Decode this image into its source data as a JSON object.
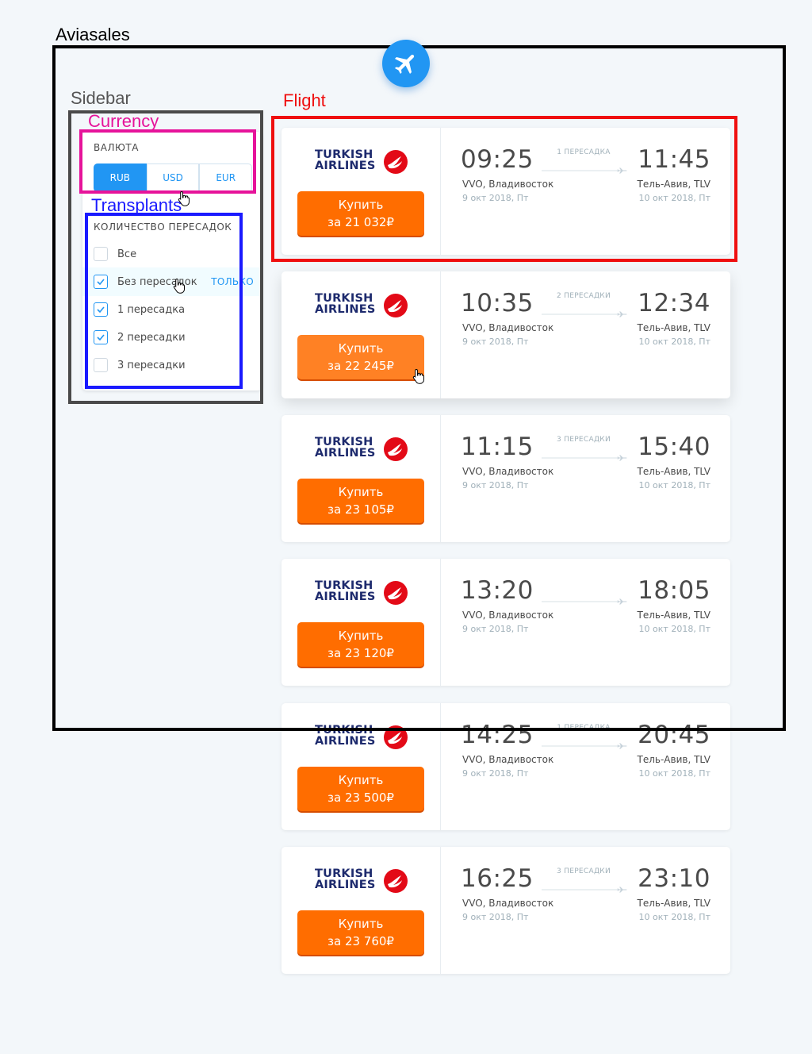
{
  "annotations": {
    "aviasales": "Aviasales",
    "sidebar": "Sidebar",
    "currency": "Currency",
    "transplants": "Transplants",
    "flight": "Flight",
    "colors": {
      "aviasales": "#000000",
      "sidebar": "#4a4a4a",
      "currency": "#e6139a",
      "transplants": "#1a1aff",
      "flight": "#ef0f0f"
    }
  },
  "logo": {
    "icon": "airplane-icon",
    "color": "#2196f3"
  },
  "sidebar": {
    "currency_title": "ВАЛЮТА",
    "currencies": [
      {
        "label": "RUB",
        "active": true
      },
      {
        "label": "USD",
        "active": false
      },
      {
        "label": "EUR",
        "active": false
      }
    ],
    "transfers_title": "КОЛИЧЕСТВО ПЕРЕСАДОК",
    "transfers": [
      {
        "label": "Все",
        "checked": false
      },
      {
        "label": "Без пересадок",
        "checked": true,
        "hover": true,
        "only": "ТОЛЬКО"
      },
      {
        "label": "1 пересадка",
        "checked": true
      },
      {
        "label": "2 пересадки",
        "checked": true
      },
      {
        "label": "3 пересадки",
        "checked": false
      }
    ]
  },
  "flights": [
    {
      "airline_line1": "TURKISH",
      "airline_line2": "AIRLINES",
      "buy_line1": "Купить",
      "buy_line2": "за 21 032₽",
      "dep_time": "09:25",
      "arr_time": "11:45",
      "stops": "1 ПЕРЕСАДКА",
      "dep_city": "VVO, Владивосток",
      "arr_city": "Тель-Авив, TLV",
      "dep_date": "9 окт 2018, Пт",
      "arr_date": "10 окт 2018, Пт"
    },
    {
      "airline_line1": "TURKISH",
      "airline_line2": "AIRLINES",
      "buy_line1": "Купить",
      "buy_line2": "за 22 245₽",
      "dep_time": "10:35",
      "arr_time": "12:34",
      "stops": "2 ПЕРЕСАДКИ",
      "dep_city": "VVO, Владивосток",
      "arr_city": "Тель-Авив, TLV",
      "dep_date": "9 окт 2018, Пт",
      "arr_date": "10 окт 2018, Пт"
    },
    {
      "airline_line1": "TURKISH",
      "airline_line2": "AIRLINES",
      "buy_line1": "Купить",
      "buy_line2": "за 23 105₽",
      "dep_time": "11:15",
      "arr_time": "15:40",
      "stops": "3 ПЕРЕСАДКИ",
      "dep_city": "VVO, Владивосток",
      "arr_city": "Тель-Авив, TLV",
      "dep_date": "9 окт 2018, Пт",
      "arr_date": "10 окт 2018, Пт"
    },
    {
      "airline_line1": "TURKISH",
      "airline_line2": "AIRLINES",
      "buy_line1": "Купить",
      "buy_line2": "за 23 120₽",
      "dep_time": "13:20",
      "arr_time": "18:05",
      "stops": "",
      "dep_city": "VVO, Владивосток",
      "arr_city": "Тель-Авив, TLV",
      "dep_date": "9 окт 2018, Пт",
      "arr_date": "10 окт 2018, Пт"
    },
    {
      "airline_line1": "TURKISH",
      "airline_line2": "AIRLINES",
      "buy_line1": "Купить",
      "buy_line2": "за 23 500₽",
      "dep_time": "14:25",
      "arr_time": "20:45",
      "stops": "1 ПЕРЕСАДКА",
      "dep_city": "VVO, Владивосток",
      "arr_city": "Тель-Авив, TLV",
      "dep_date": "9 окт 2018, Пт",
      "arr_date": "10 окт 2018, Пт"
    },
    {
      "airline_line1": "TURKISH",
      "airline_line2": "AIRLINES",
      "buy_line1": "Купить",
      "buy_line2": "за 23 760₽",
      "dep_time": "16:25",
      "arr_time": "23:10",
      "stops": "3 ПЕРЕСАДКИ",
      "dep_city": "VVO, Владивосток",
      "arr_city": "Тель-Авив, TLV",
      "dep_date": "9 окт 2018, Пт",
      "arr_date": "10 окт 2018, Пт"
    }
  ],
  "colors": {
    "accent": "#2196f3",
    "buy_button": "#ff6d00",
    "airline_red": "#e30a17",
    "airline_navy": "#1d2a6d"
  }
}
